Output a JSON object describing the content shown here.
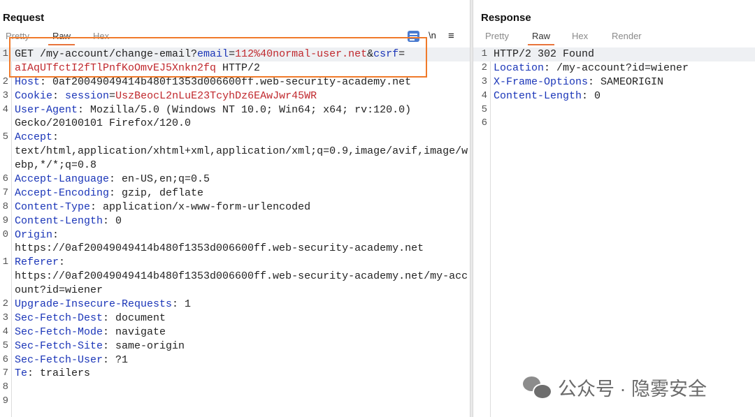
{
  "request": {
    "title": "Request",
    "tabs": [
      "Pretty",
      "Raw",
      "Hex"
    ],
    "active_tab": "Raw",
    "toolbar": {
      "newline_label": "\\n",
      "menu_label": "≡"
    },
    "lines": [
      {
        "n": "1",
        "segs": [
          [
            "v",
            "GET /my-account/change-email?"
          ],
          [
            "k",
            "email"
          ],
          [
            "v",
            "="
          ],
          [
            "r",
            "112%40normal-user.net"
          ],
          [
            "v",
            "&"
          ],
          [
            "k",
            "csrf"
          ],
          [
            "v",
            "="
          ]
        ]
      },
      {
        "n": "",
        "segs": [
          [
            "r",
            "aIAqUTfctI2fTlPnfKoOmvEJ5Xnkn2fq"
          ],
          [
            "v",
            " HTTP/2"
          ]
        ]
      },
      {
        "n": "2",
        "segs": [
          [
            "k",
            "Host"
          ],
          [
            "v",
            ": 0af20049049414b480f1353d006600ff.web-security-academy.net"
          ]
        ]
      },
      {
        "n": "3",
        "segs": [
          [
            "k",
            "Cookie"
          ],
          [
            "v",
            ": "
          ],
          [
            "k",
            "session"
          ],
          [
            "v",
            "="
          ],
          [
            "r",
            "UszBeocL2nLuE23TcyhDz6EAwJwr45WR"
          ]
        ]
      },
      {
        "n": "4",
        "segs": [
          [
            "k",
            "User-Agent"
          ],
          [
            "v",
            ": Mozilla/5.0 (Windows NT 10.0; Win64; x64; rv:120.0)"
          ]
        ]
      },
      {
        "n": "",
        "segs": [
          [
            "v",
            "Gecko/20100101 Firefox/120.0"
          ]
        ]
      },
      {
        "n": "5",
        "segs": [
          [
            "k",
            "Accept"
          ],
          [
            "v",
            ":"
          ]
        ]
      },
      {
        "n": "",
        "segs": [
          [
            "v",
            "text/html,application/xhtml+xml,application/xml;q=0.9,image/avif,image/w"
          ]
        ]
      },
      {
        "n": "",
        "segs": [
          [
            "v",
            "ebp,*/*;q=0.8"
          ]
        ]
      },
      {
        "n": "6",
        "segs": [
          [
            "k",
            "Accept-Language"
          ],
          [
            "v",
            ": en-US,en;q=0.5"
          ]
        ]
      },
      {
        "n": "7",
        "segs": [
          [
            "k",
            "Accept-Encoding"
          ],
          [
            "v",
            ": gzip, deflate"
          ]
        ]
      },
      {
        "n": "8",
        "segs": [
          [
            "k",
            "Content-Type"
          ],
          [
            "v",
            ": application/x-www-form-urlencoded"
          ]
        ]
      },
      {
        "n": "9",
        "segs": [
          [
            "k",
            "Content-Length"
          ],
          [
            "v",
            ": 0"
          ]
        ]
      },
      {
        "n": "0",
        "segs": [
          [
            "k",
            "Origin"
          ],
          [
            "v",
            ":"
          ]
        ]
      },
      {
        "n": "",
        "segs": [
          [
            "v",
            "https://0af20049049414b480f1353d006600ff.web-security-academy.net"
          ]
        ]
      },
      {
        "n": "1",
        "segs": [
          [
            "k",
            "Referer"
          ],
          [
            "v",
            ":"
          ]
        ]
      },
      {
        "n": "",
        "segs": [
          [
            "v",
            "https://0af20049049414b480f1353d006600ff.web-security-academy.net/my-acc"
          ]
        ]
      },
      {
        "n": "",
        "segs": [
          [
            "v",
            "ount?id=wiener"
          ]
        ]
      },
      {
        "n": "2",
        "segs": [
          [
            "k",
            "Upgrade-Insecure-Requests"
          ],
          [
            "v",
            ": 1"
          ]
        ]
      },
      {
        "n": "3",
        "segs": [
          [
            "k",
            "Sec-Fetch-Dest"
          ],
          [
            "v",
            ": document"
          ]
        ]
      },
      {
        "n": "4",
        "segs": [
          [
            "k",
            "Sec-Fetch-Mode"
          ],
          [
            "v",
            ": navigate"
          ]
        ]
      },
      {
        "n": "5",
        "segs": [
          [
            "k",
            "Sec-Fetch-Site"
          ],
          [
            "v",
            ": same-origin"
          ]
        ]
      },
      {
        "n": "6",
        "segs": [
          [
            "k",
            "Sec-Fetch-User"
          ],
          [
            "v",
            ": ?1"
          ]
        ]
      },
      {
        "n": "7",
        "segs": [
          [
            "k",
            "Te"
          ],
          [
            "v",
            ": trailers"
          ]
        ]
      },
      {
        "n": "8",
        "segs": []
      },
      {
        "n": "9",
        "segs": []
      }
    ]
  },
  "response": {
    "title": "Response",
    "tabs": [
      "Pretty",
      "Raw",
      "Hex",
      "Render"
    ],
    "active_tab": "Raw",
    "lines": [
      {
        "n": "1",
        "segs": [
          [
            "v",
            "HTTP/2 302 Found"
          ]
        ]
      },
      {
        "n": "2",
        "segs": [
          [
            "k",
            "Location"
          ],
          [
            "v",
            ": /my-account?id=wiener"
          ]
        ]
      },
      {
        "n": "3",
        "segs": [
          [
            "k",
            "X-Frame-Options"
          ],
          [
            "v",
            ": SAMEORIGIN"
          ]
        ]
      },
      {
        "n": "4",
        "segs": [
          [
            "k",
            "Content-Length"
          ],
          [
            "v",
            ": 0"
          ]
        ]
      },
      {
        "n": "5",
        "segs": []
      },
      {
        "n": "6",
        "segs": []
      }
    ]
  },
  "watermark": {
    "text": "公众号 · 隐雾安全"
  },
  "colors": {
    "header_key": "#1a35b8",
    "value_red": "#c0282d",
    "accent_orange": "#e8743b",
    "highlight_box": "#f07a2a"
  }
}
